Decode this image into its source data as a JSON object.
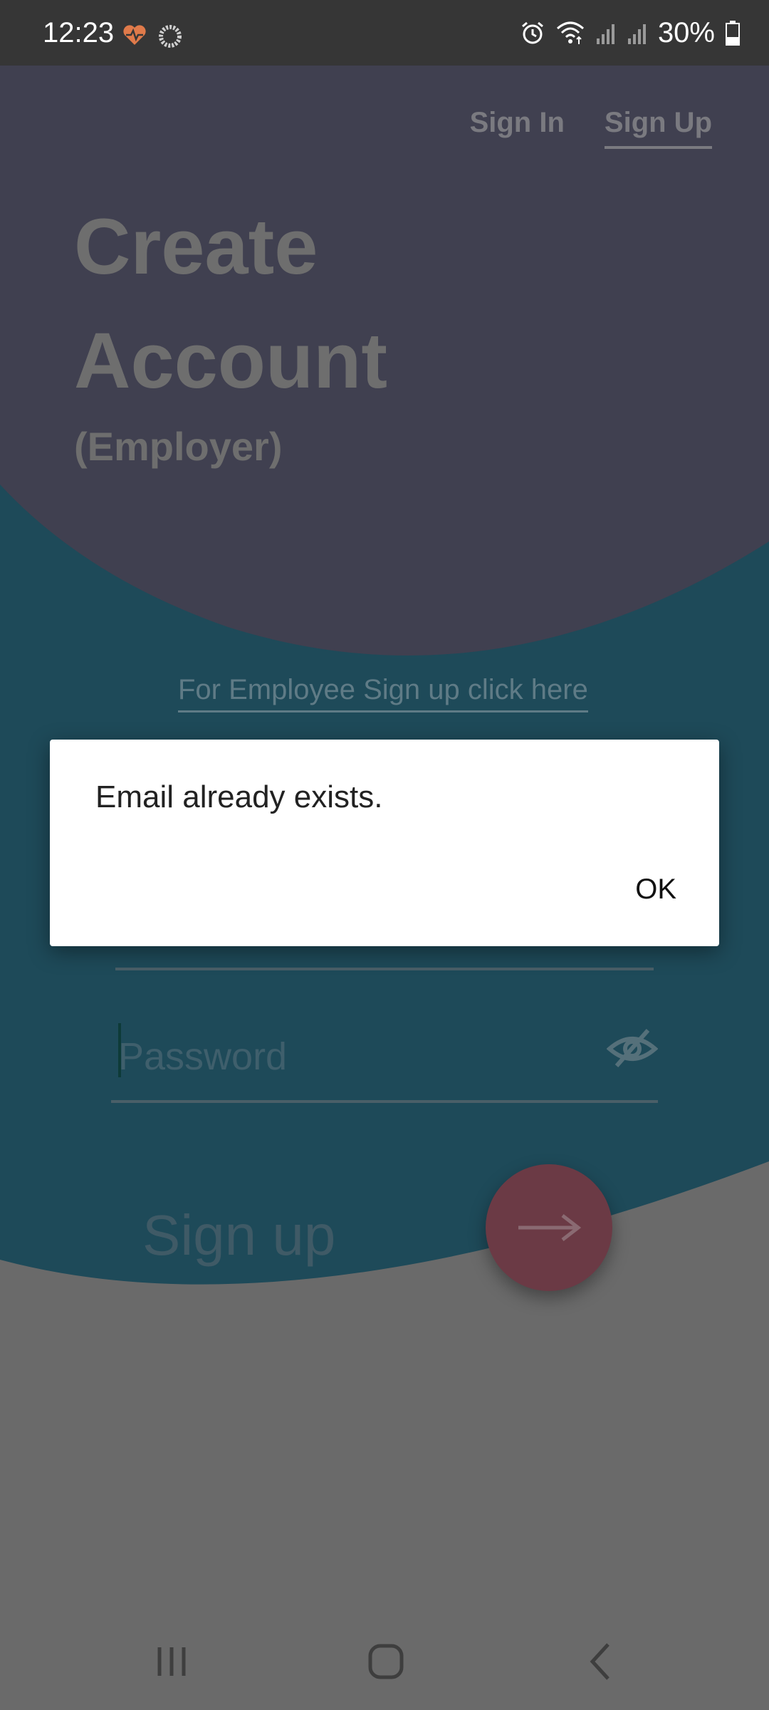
{
  "status_bar": {
    "time": "12:23",
    "battery": "30%",
    "icons": [
      "heart-icon",
      "ring-icon",
      "alarm-icon",
      "wifi-icon",
      "signal-icon",
      "signal-icon",
      "battery-icon"
    ]
  },
  "nav": {
    "sign_in": "Sign In",
    "sign_up": "Sign Up"
  },
  "header": {
    "line1": "Create",
    "line2": "Account",
    "subtitle": "(Employer)"
  },
  "employee_link": "For Employee Sign up click here",
  "password": {
    "placeholder": "Password",
    "value": ""
  },
  "signup_label": "Sign up",
  "dialog": {
    "message": "Email already exists.",
    "ok_label": "OK"
  },
  "colors": {
    "top_wave": "#404050",
    "mid_wave": "#1e4a59",
    "scrim_bottom": "#6a6a6a",
    "fab": "#6b3a45"
  }
}
